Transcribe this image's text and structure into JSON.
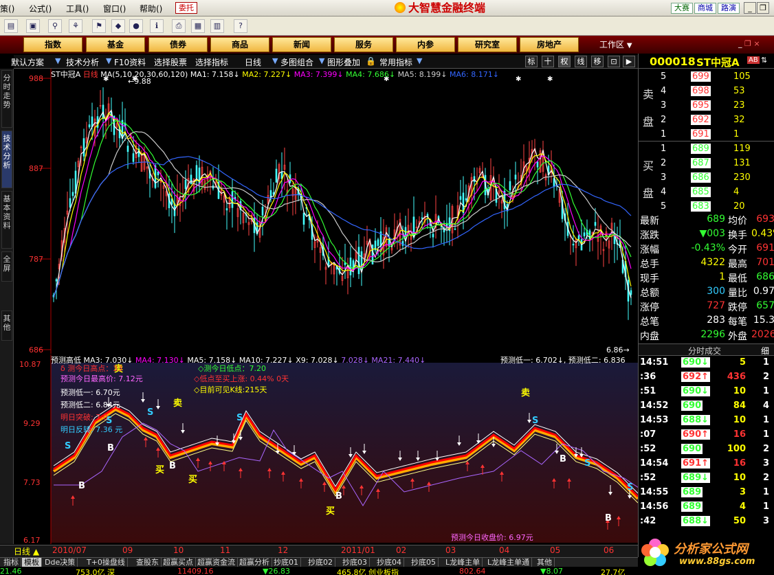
{
  "menu": [
    "策(",
    ")",
    "公式(",
    ")",
    "工具(",
    ")",
    "窗口(",
    ")",
    "帮助(",
    ")"
  ],
  "menu_items": [
    "策()",
    "公式()",
    "工具()",
    "窗口()",
    "帮助()"
  ],
  "weituo": "委托",
  "app_title": "大智慧金融终端",
  "right_links": [
    "大赛",
    "商城",
    "路演"
  ],
  "nav": [
    "指数",
    "基金",
    "债券",
    "商品",
    "新闻",
    "服务",
    "内参",
    "研究室",
    "房地产"
  ],
  "workarea": "工作区",
  "tabs": [
    "默认方案",
    "技术分析",
    "F10资料",
    "选择股票",
    "选择指标",
    "日线",
    "多图组合",
    "图形叠加",
    "常用指标"
  ],
  "view_btns": [
    "标",
    "十",
    "权",
    "线",
    "移"
  ],
  "left_tabs": [
    "分时走势",
    "技术分析",
    "基本资料",
    "全屏",
    "其他"
  ],
  "upper_header": {
    "name": "ST中冠A",
    "period": "日线",
    "ma": "MA(5,10,20,30,60,120)",
    "ma1": "MA1: 7.158↓",
    "ma2": "MA2: 7.227↓",
    "ma3": "MA3: 7.399↓",
    "ma4": "MA4: 7.686↓",
    "ma5": "MA5: 8.199↓",
    "ma6": "MA6: 8.171↓"
  },
  "upper_axis": [
    "988",
    "887",
    "787",
    "686"
  ],
  "upper_marks": {
    "high": "9.88",
    "low": "6.86"
  },
  "lower_header": {
    "name": "预测高低",
    "ma3": "MA3: 7.030↓",
    "ma4": "MA4: 7.130↓",
    "ma5": "MA5: 7.158↓",
    "ma10": "MA10: 7.227↓",
    "x9": "X9: 7.028↓",
    "x": "7.028↓",
    "ma21": "MA21: 7.440↓",
    "low1": "预测低一: 6.702↓",
    "low2": "预测低二: 6.836"
  },
  "lower_axis": [
    "10.87",
    "9.29",
    "7.73",
    "6.17"
  ],
  "lower_notes": {
    "a": "δ 测今日高点：33",
    "b": "预测今日最高价: 7.12元",
    "c": "◇测今日低点：7.20",
    "d": "◇低点至买上涨: 0.44%  0天",
    "e": "◇目前可见K线:215天",
    "f": "预测低一: 6.70元",
    "g": "预测低二: 6.84元",
    "h": "明日突破: 7.0",
    "i": "明日反转: 7.36 元",
    "j": "预测今日收盘价: 6.97元"
  },
  "signals": {
    "buy": "买",
    "sell": "卖",
    "b": "B",
    "s": "S"
  },
  "period_label": "日线",
  "dates": [
    "2010/07",
    "09",
    "10",
    "11",
    "12",
    "2011/01",
    "02",
    "03",
    "04",
    "05",
    "06"
  ],
  "bottom_tabs": [
    "指标",
    "模板",
    "Dde决策",
    "T+0操盘线",
    "查股东",
    "超赢买点",
    "超赢资金流",
    "超赢分析",
    "抄底01",
    "抄底02",
    "抄底03",
    "抄底04",
    "抄底05",
    "L龙峰主单",
    "L龙峰主单通",
    "其他"
  ],
  "status": [
    "21.46",
    "753.0亿 深",
    "11409.16",
    "▼26.83",
    "465.8亿 创业板指",
    "802.64",
    "▼8.07",
    "27.7亿"
  ],
  "quote": {
    "code": "000018",
    "name": "ST中冠A",
    "ab": "AB",
    "sell_label": [
      "卖",
      "盘"
    ],
    "buy_label": [
      "买",
      "盘"
    ],
    "asks": [
      [
        "5",
        "699",
        "105"
      ],
      [
        "4",
        "698",
        "53"
      ],
      [
        "3",
        "695",
        "23"
      ],
      [
        "2",
        "692",
        "32"
      ],
      [
        "1",
        "691",
        "1"
      ]
    ],
    "bids": [
      [
        "1",
        "689",
        "119"
      ],
      [
        "2",
        "687",
        "131"
      ],
      [
        "3",
        "686",
        "230"
      ],
      [
        "4",
        "685",
        "4"
      ],
      [
        "5",
        "683",
        "20"
      ]
    ],
    "stats": [
      [
        "最新",
        "689",
        "均价",
        "693"
      ],
      [
        "涨跌",
        "▼003",
        "换手",
        "0.43%"
      ],
      [
        "涨幅",
        "-0.43%",
        "今开",
        "691"
      ],
      [
        "总手",
        "4322",
        "最高",
        "701"
      ],
      [
        "现手",
        "1",
        "最低",
        "686"
      ],
      [
        "总额",
        "300",
        "量比",
        "0.97"
      ],
      [
        "涨停",
        "727",
        "跌停",
        "657"
      ],
      [
        "总笔",
        "283",
        "每笔",
        "15.3"
      ],
      [
        "内盘",
        "2296",
        "外盘",
        "2026"
      ]
    ],
    "ticks_title": "分时成交",
    "ticks_detail": "细",
    "ticks": [
      [
        "14:51",
        "690↓",
        "5",
        "1"
      ],
      [
        ":36",
        "692↑",
        "436",
        "2"
      ],
      [
        ":51",
        "690↓",
        "10",
        "1"
      ],
      [
        "14:52",
        "690",
        "84",
        "4"
      ],
      [
        "14:53",
        "688↓",
        "10",
        "1"
      ],
      [
        ":07",
        "690↑",
        "16",
        "1"
      ],
      [
        ":52",
        "690",
        "100",
        "2"
      ],
      [
        "14:54",
        "691↑",
        "16",
        "3"
      ],
      [
        ":52",
        "689↓",
        "10",
        "2"
      ],
      [
        "14:55",
        "689",
        "3",
        "1"
      ],
      [
        "14:56",
        "689",
        "4",
        "1"
      ],
      [
        ":42",
        "688↓",
        "50",
        "3"
      ]
    ]
  },
  "watermark": {
    "title": "分析家公式网",
    "url": "www.88gs.com"
  }
}
